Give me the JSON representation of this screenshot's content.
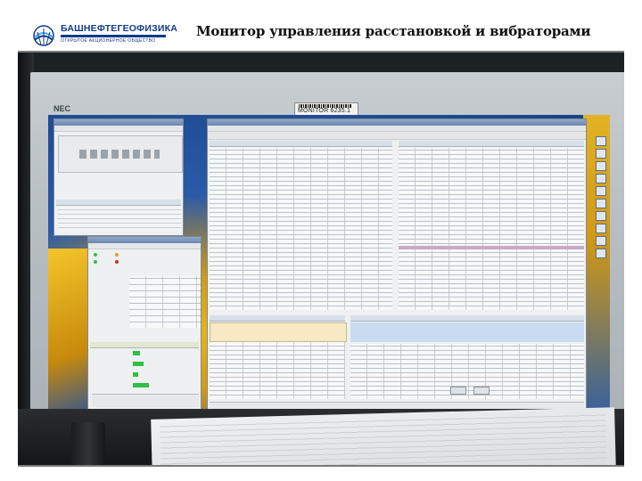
{
  "header": {
    "logo": {
      "name": "БАШНЕФТЕГЕОФИЗИКА",
      "subtitle": "ОТКРЫТОЕ АКЦИОНЕРНОЕ ОБЩЕСТВО",
      "colors": {
        "brand": "#0f3a8a",
        "accent": "#3fa9f5"
      }
    },
    "title": "Монитор управления расстановкой и вибраторами"
  },
  "photo": {
    "monitor_label": "MONITOR 6235.1",
    "brand": "NEC"
  }
}
